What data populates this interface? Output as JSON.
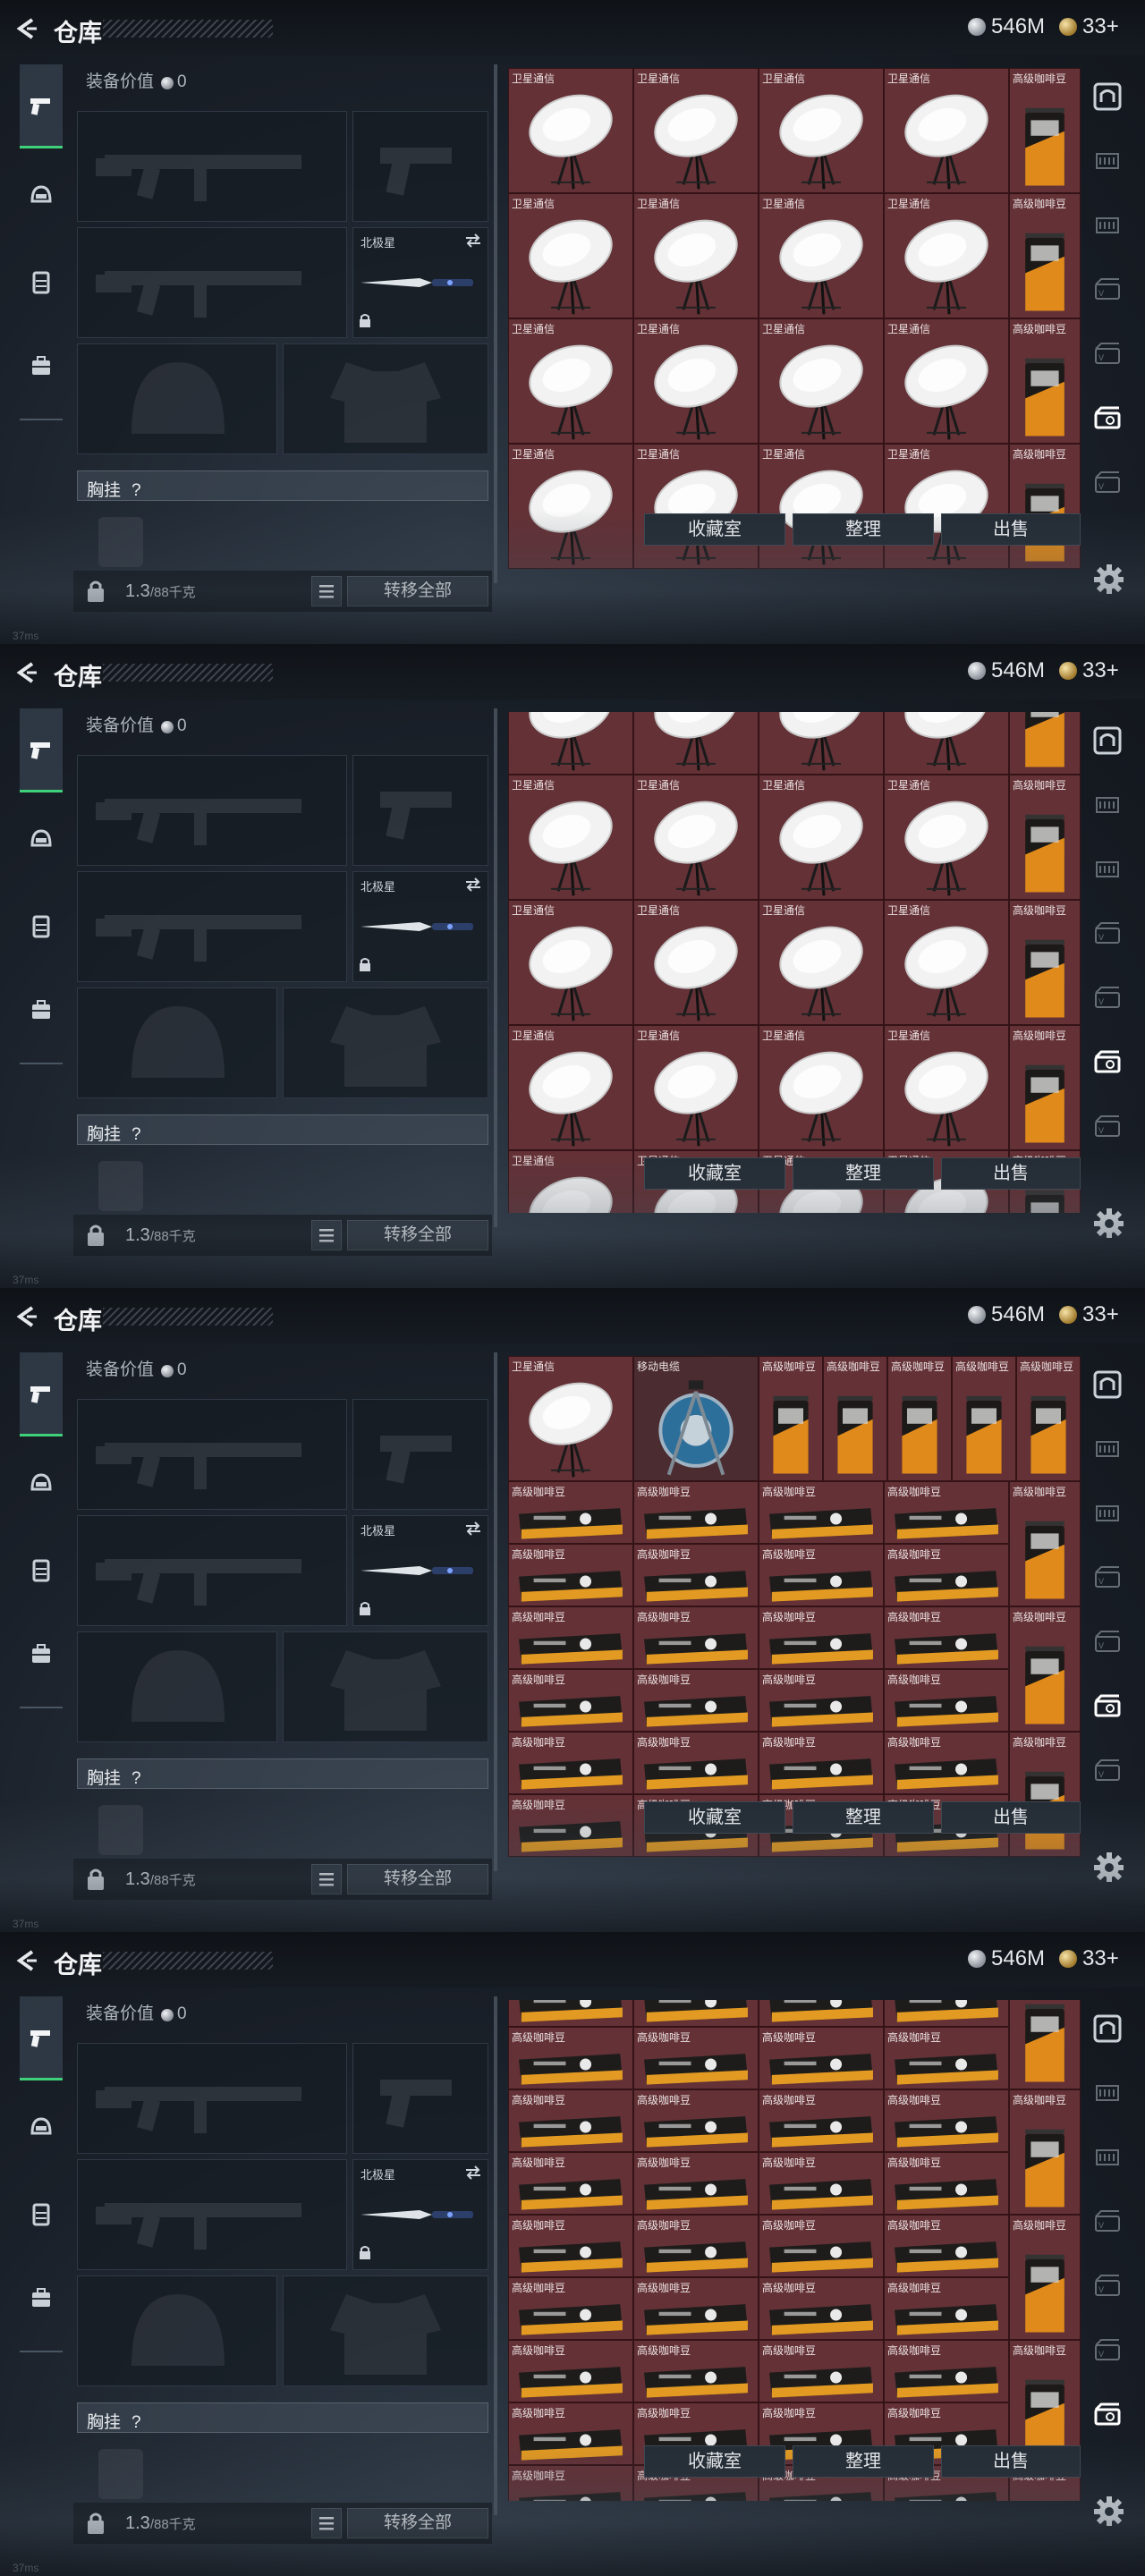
{
  "header": {
    "title": "仓库",
    "currency_silver": "546M",
    "currency_gold": "33+"
  },
  "equipment": {
    "value_label": "装备价值",
    "value": "0",
    "knife_name": "北极星",
    "vest_label": "胸挂",
    "vest_help": "?",
    "weight_current": "1.3",
    "weight_max": "/88千克",
    "transfer_all": "转移全部"
  },
  "actions": {
    "collection_room": "收藏室",
    "organize": "整理",
    "sell": "出售"
  },
  "status": {
    "ping": "37ms"
  },
  "items": {
    "satellite": "卫星通信",
    "coffee": "高级咖啡豆",
    "cable": "移动电缆"
  },
  "colors": {
    "grid_bg": "#5a2c31",
    "accent_green": "#3fd07a"
  },
  "icons": {
    "back": "back-arrow-icon",
    "rail": [
      "pistol-icon",
      "helmet-icon",
      "vest-icon",
      "backpack-icon"
    ],
    "right_rail": [
      "safe-icon",
      "ammo-icon",
      "ammo-icon",
      "case-icon",
      "case-icon",
      "case-icon",
      "case-icon",
      "settings-gear-icon"
    ]
  }
}
